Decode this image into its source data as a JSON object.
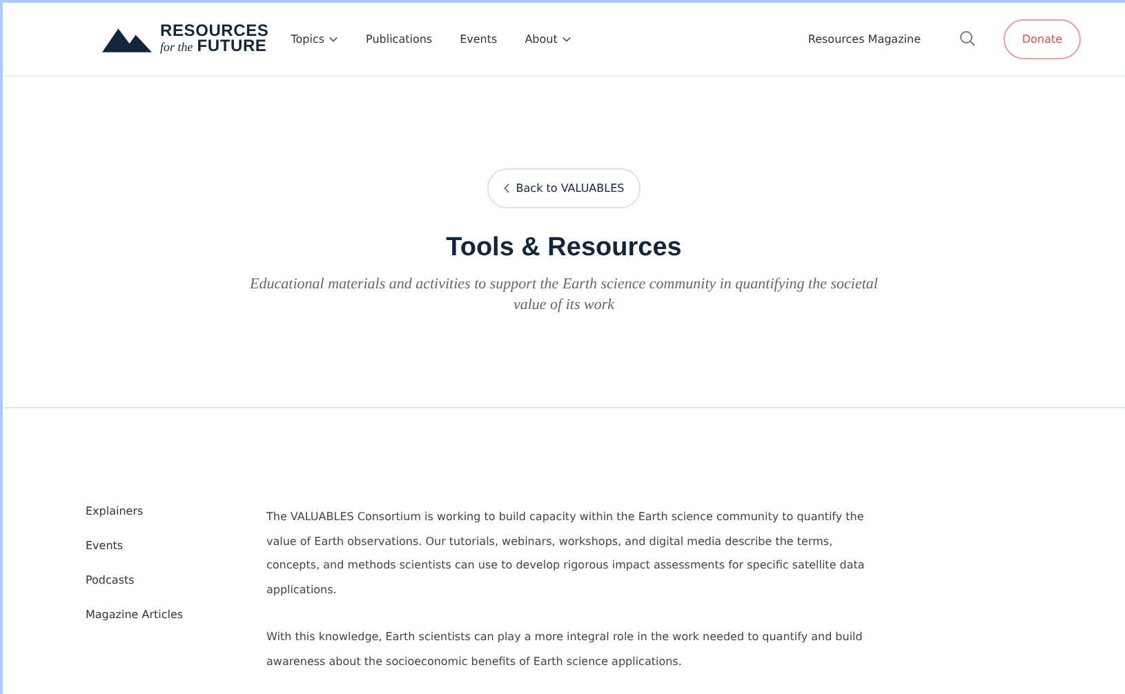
{
  "logo": {
    "line1": "RESOURCES",
    "line2_prefix": "for the",
    "line2": "FUTURE"
  },
  "nav": [
    {
      "label": "Topics",
      "dropdown": true
    },
    {
      "label": "Publications",
      "dropdown": false
    },
    {
      "label": "Events",
      "dropdown": false
    },
    {
      "label": "About",
      "dropdown": true
    }
  ],
  "magazine_link": "Resources Magazine",
  "donate_button": "Donate",
  "back_button": "Back to VALUABLES",
  "title": "Tools & Resources",
  "subtitle": "Educational materials and activities to support the Earth science community in quantifying the societal value of its work",
  "sidebar": {
    "items": [
      "Explainers",
      "Events",
      "Podcasts",
      "Magazine Articles"
    ]
  },
  "paragraphs": [
    "The VALUABLES Consortium is working to build capacity within the Earth science community to quantify the value of Earth observations. Our tutorials, webinars, workshops, and digital media describe the terms, concepts, and methods scientists can use to develop rigorous impact assessments for specific satellite data applications.",
    "With this knowledge, Earth scientists can play a more integral role in the work needed to quantify and build awareness about the socioeconomic benefits of Earth science applications."
  ]
}
